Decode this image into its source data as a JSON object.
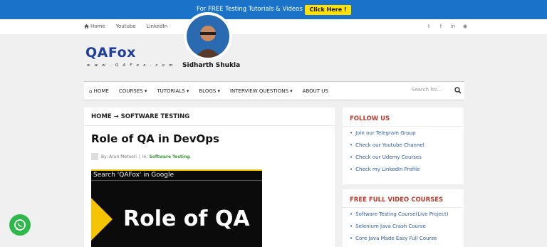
{
  "promo": {
    "text": "For FREE Testing Tutorials & Videos",
    "button": "Click Here !",
    "bg_color": "#1a73c9",
    "button_color": "#ffe100"
  },
  "topbar": {
    "links": [
      "Home",
      "Youtube",
      "LinkedIn"
    ],
    "social_icons": [
      "twitter-icon",
      "facebook-icon",
      "linkedin-icon",
      "rss-icon"
    ]
  },
  "logo": {
    "name": "QAFox",
    "tagline": "w w w . Q A F o x . c o m"
  },
  "nav": {
    "items": [
      "HOME",
      "COURSES",
      "TUTORIALS",
      "BLOGS",
      "INTERVIEW QUESTIONS",
      "ABOUT US"
    ],
    "search_placeholder": "Search for..."
  },
  "article": {
    "breadcrumb": "HOME → SOFTWARE TESTING",
    "title": "Role of QA in DevOps",
    "meta_by": "By: Arun Motoori",
    "meta_in": "In:",
    "category": "Software Testing",
    "hero": {
      "search_text": "Search 'QAFox' in Google",
      "big_text": "Role of QA",
      "name": "Sidharth Shukla"
    }
  },
  "sidebar": {
    "follow": {
      "title": "FOLLOW US",
      "links": [
        "Join our Telegram Group",
        "Check our Youtube Channel",
        "Check our Udemy Courses",
        "Check my LinkedIn Profile"
      ]
    },
    "courses": {
      "title": "FREE FULL VIDEO COURSES",
      "links": [
        "Software Testing Course(Live Project)",
        "Selenium Java Crash Course",
        "Core Java Made Easy Full Course"
      ]
    }
  },
  "accent_colors": {
    "heading_red": "#c0392b",
    "link_blue": "#2a5ca8",
    "category_green": "#3a9a3a",
    "whatsapp_green": "#2eb84b"
  }
}
